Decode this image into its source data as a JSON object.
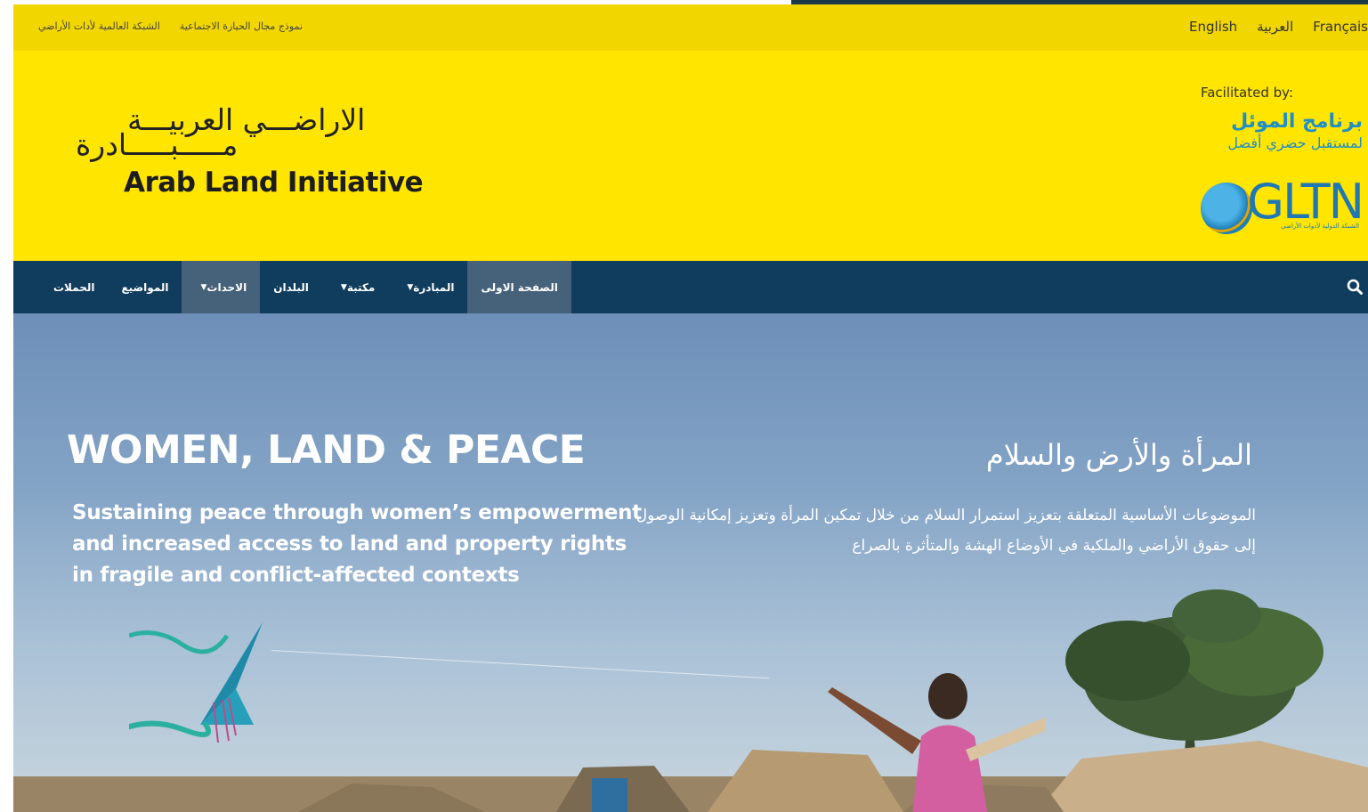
{
  "top_bar": {
    "links": [
      "نموذج مجال الحيازة الاجتماعية",
      "الشبكة العالمية لأدات الأراضي"
    ],
    "languages": [
      "English",
      "العربية",
      "Français"
    ]
  },
  "header": {
    "logo_ar_line1": "الاراضـــي العربيـــة",
    "logo_ar_line2": "مـــــبـــــادرة",
    "logo_en": "Arab Land Initiative",
    "facilitated_label": "Facilitated by:",
    "habitat_line1": "برنامج الموئل",
    "habitat_line2": "لمستقبل حضري أفضل",
    "gltn_text": "GLTN",
    "gltn_sub": "الشبكة الدولية لأدوات الأراضي"
  },
  "nav": {
    "items": [
      {
        "label": "الصفحة الاولى",
        "dropdown": false,
        "active": true
      },
      {
        "label": "المبادرة",
        "dropdown": true,
        "active": false
      },
      {
        "label": "مكتبة",
        "dropdown": true,
        "active": false
      },
      {
        "label": "البلدان",
        "dropdown": false,
        "active": false
      },
      {
        "label": "الاحداث",
        "dropdown": true,
        "active": true
      },
      {
        "label": "المواضيع",
        "dropdown": false,
        "active": false
      },
      {
        "label": "الحملات",
        "dropdown": false,
        "active": false
      }
    ]
  },
  "hero": {
    "title_en": "WOMEN, LAND & PEACE",
    "subtitle_en": "Sustaining peace through women’s empowerment and increased access to land and property rights in fragile and conflict-affected contexts",
    "title_ar": "المرأة والأرض والسلام",
    "subtitle_ar": "الموضوعات الأساسية المتعلقة بتعزيز استمرار السلام من خلال تمكين المرأة وتعزيز إمكانية الوصول إلى حقوق الأراضي والملكية في الأوضاع الهشة والمتأثرة بالصراع"
  },
  "colors": {
    "topbar": "#f2d600",
    "header": "#ffe500",
    "navbar": "#103d5e",
    "nav_active": "#46617a",
    "habitat_blue": "#1f8fc8"
  },
  "icons": [
    "search-icon",
    "caret-down-icon",
    "globe-icon"
  ]
}
